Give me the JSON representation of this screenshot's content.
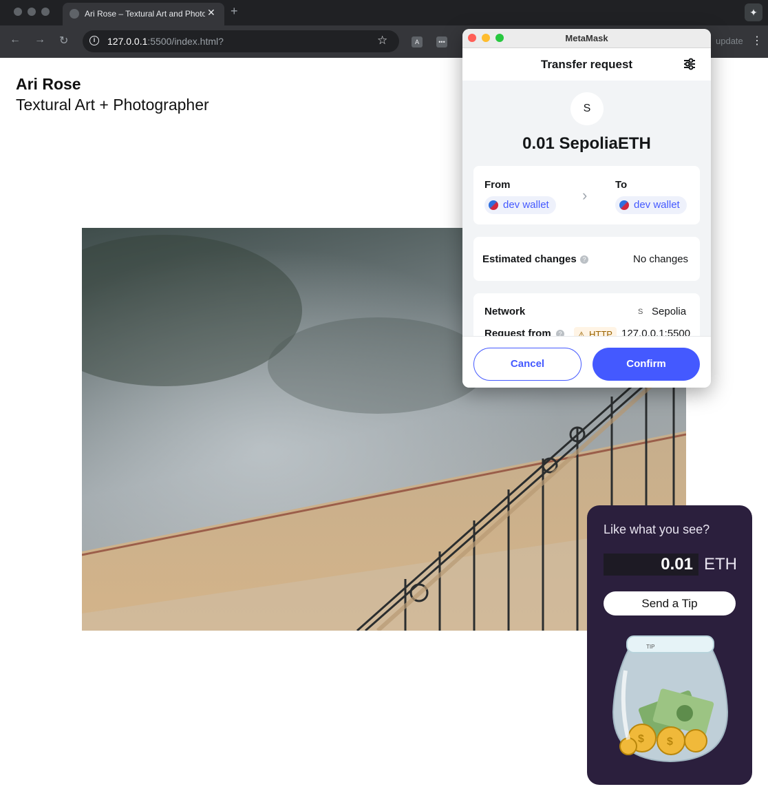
{
  "browser": {
    "tab_title": "Ari Rose – Textural Art and Photographer",
    "new_tab_symbol": "+",
    "url_host": "127.0.0.1",
    "url_rest": ":5500/index.html?",
    "update_label": "update",
    "extension_1": "A",
    "extension_2": "•••"
  },
  "page": {
    "artist_name": "Ari Rose",
    "artist_subtitle": "Textural Art + Photographer"
  },
  "tip_widget": {
    "prompt": "Like what you see?",
    "amount": "0.01",
    "unit": "ETH",
    "send_label": "Send a Tip",
    "jar_label": "TIP"
  },
  "metamask": {
    "window_title": "MetaMask",
    "header_title": "Transfer request",
    "token_initial": "S",
    "amount": "0.01 SepoliaETH",
    "from_label": "From",
    "from_account": "dev wallet",
    "to_label": "To",
    "to_account": "dev wallet",
    "estimated_changes_label": "Estimated changes",
    "estimated_changes_value": "No changes",
    "network_label": "Network",
    "network_initial": "S",
    "network_value": "Sepolia",
    "request_from_label": "Request from",
    "http_badge": "HTTP",
    "request_from_value": "127.0.0.1:5500",
    "cancel_label": "Cancel",
    "confirm_label": "Confirm"
  },
  "colors": {
    "metamask_primary": "#4459ff",
    "tip_widget_bg": "#2b1f3d",
    "browser_chrome": "#202124"
  }
}
